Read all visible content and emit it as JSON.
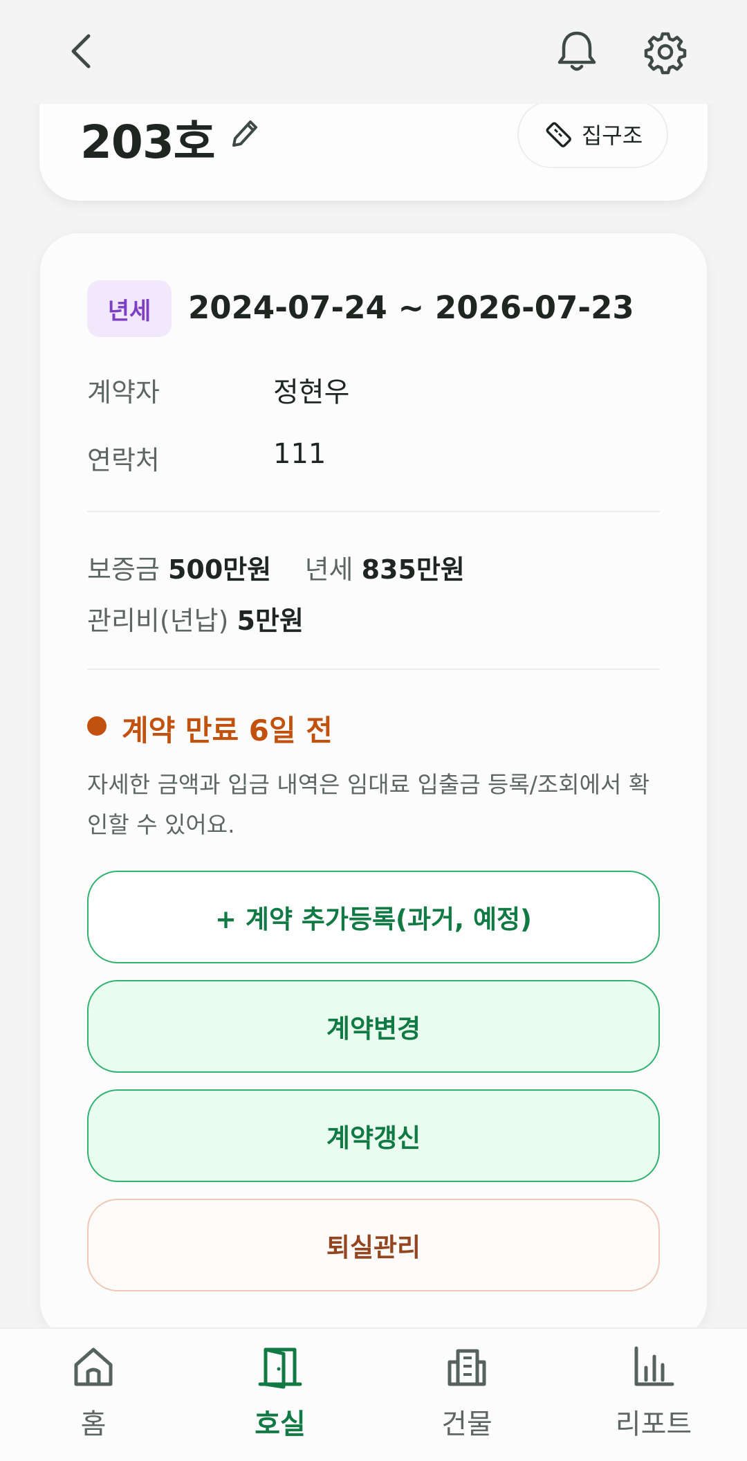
{
  "room": {
    "title": "203호",
    "floorplan_label": "집구조"
  },
  "contract": {
    "type_badge": "년세",
    "period": "2024-07-24 ~ 2026-07-23",
    "contractor_label": "계약자",
    "contractor_value": "정현우",
    "contact_label": "연락처",
    "contact_value": "111",
    "deposit_label": "보증금",
    "deposit_value": "500만원",
    "rent_label": "년세",
    "rent_value": "835만원",
    "mgmt_label": "관리비(년납)",
    "mgmt_value": "5만원",
    "expiry_text": "계약 만료 6일 전",
    "notice": "자세한 금액과 입금 내역은 임대료 입출금 등록/조회에서 확인할 수 있어요."
  },
  "actions": {
    "add_label": "+ 계약 추가등록(과거, 예정)",
    "change_label": "계약변경",
    "renew_label": "계약갱신",
    "moveout_label": "퇴실관리"
  },
  "nav": {
    "home": "홈",
    "room": "호실",
    "building": "건물",
    "report": "리포트"
  },
  "colors": {
    "accent_green": "#117a44",
    "warning_orange": "#c2510e",
    "badge_purple": "#7d3fc4",
    "moveout_brown": "#93451f"
  }
}
